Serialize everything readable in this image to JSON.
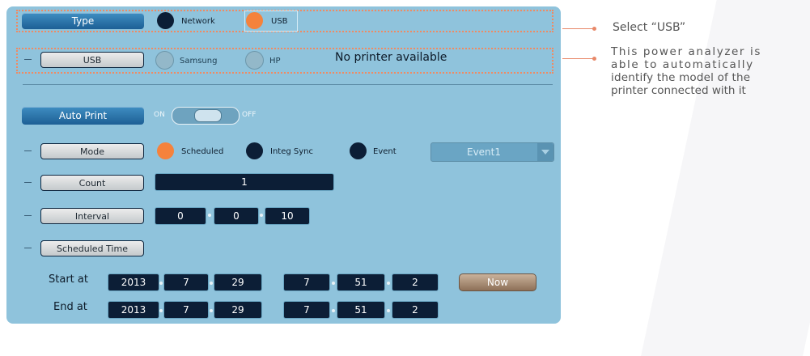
{
  "type_section": {
    "header": "Type",
    "network_label": "Network",
    "usb_label": "USB"
  },
  "usb_section": {
    "label": "USB",
    "samsung_label": "Samsung",
    "hp_label": "HP",
    "status": "No printer available"
  },
  "auto_print": {
    "header": "Auto Print",
    "on_label": "ON",
    "off_label": "OFF",
    "mode_label": "Mode",
    "mode_options": [
      "Scheduled",
      "Integ Sync",
      "Event"
    ],
    "event_select": "Event1",
    "count_label": "Count",
    "count_value": "1",
    "interval_label": "Interval",
    "interval_values": [
      "0",
      "0",
      "10"
    ],
    "scheduled_time_label": "Scheduled Time",
    "start_label": "Start at",
    "start_date": [
      "2013",
      "7",
      "29"
    ],
    "start_time": [
      "7",
      "51",
      "2"
    ],
    "end_label": "End at",
    "end_date": [
      "2013",
      "7",
      "29"
    ],
    "end_time": [
      "7",
      "51",
      "2"
    ],
    "now_button": "Now"
  },
  "annotations": {
    "select_usb": "Select “USB”",
    "detect_note": [
      "This power analyzer is",
      "able to automatically",
      "identify the model of the",
      "printer connected with it"
    ]
  },
  "colors": {
    "panel_bg": "#8fc3dc",
    "selected_radio": "#f5823c",
    "dark_field": "#0c1e36",
    "callout": "#e8896a"
  }
}
